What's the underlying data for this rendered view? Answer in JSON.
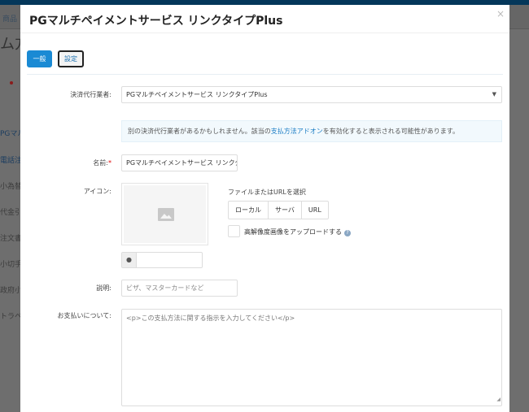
{
  "background": {
    "nav_item": "商品",
    "page_title": "ム方",
    "list_items": [
      "PGマル",
      "電話注",
      "小為替",
      "代金引",
      "注文書",
      "小切手",
      "政府小",
      "トラベ"
    ]
  },
  "modal": {
    "title": "PGマルチペイメントサービス リンクタイプPlus",
    "close_icon": "×",
    "tabs": [
      {
        "label": "一般",
        "active": true
      },
      {
        "label": "設定",
        "active": false
      }
    ],
    "processor": {
      "label": "決済代行業者:",
      "value": "PGマルチペイメントサービス リンクタイプPlus"
    },
    "info": {
      "before": "別の決済代行業者があるかもしれません。該当の",
      "link": "支払方法アドオン",
      "after": "を有効化すると表示される可能性があります。"
    },
    "name": {
      "label": "名前:",
      "required_mark": "*",
      "value": "PGマルチペイメントサービス リンクタイプPlus"
    },
    "icon": {
      "label": "アイコン:",
      "select_text": "ファイルまたはURLを選択",
      "sources": [
        "ローカル",
        "サーバ",
        "URL"
      ],
      "hires_label": "高解像度画像をアップロードする",
      "help": "?"
    },
    "description": {
      "label": "説明:",
      "placeholder": "ビザ、マスターカードなど"
    },
    "instructions": {
      "label": "お支払いについて:",
      "placeholder": "<p>この支払方法に関する指示を入力してください</p>"
    }
  },
  "colors": {
    "primary": "#1a8ad4",
    "link": "#1a7cc4",
    "topbar": "#04375a"
  }
}
